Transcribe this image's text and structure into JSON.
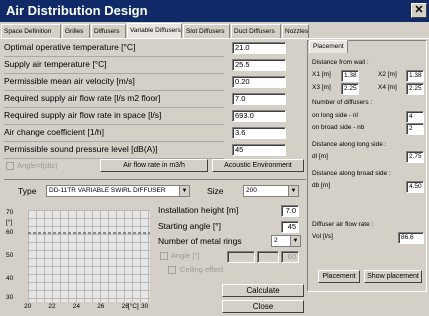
{
  "window": {
    "title": "Air Distribution Design",
    "close_glyph": "✕"
  },
  "tabs": [
    {
      "label": "Space Definition"
    },
    {
      "label": "Grilles"
    },
    {
      "label": "Diffusers"
    },
    {
      "label": "Variable Diffusers"
    },
    {
      "label": "Slot Diffusers"
    },
    {
      "label": "Duct Diffusers"
    },
    {
      "label": "Nozzles"
    }
  ],
  "params": [
    {
      "label": "Optimal operative temperature   [°C]",
      "value": "21.0"
    },
    {
      "label": "Supply air temperature   [°C]",
      "value": "25.5"
    },
    {
      "label": "Permissible mean air velocity   [m/s]",
      "value": "0.20"
    },
    {
      "label": "Required supply air flow rate   [l/s m2 floor]",
      "value": "7.0"
    },
    {
      "label": "Required supply air flow rate in space   [l/s]",
      "value": "693.0"
    },
    {
      "label": "Air change coefficient   [1/h]",
      "value": "3.6"
    },
    {
      "label": "Permissible sound pressure level   [dB(A)]",
      "value": "45"
    }
  ],
  "angle_check_label": "Angle=f(dtz)",
  "buttons": {
    "air_flow": "Air flow rate in m3/h",
    "acoustic": "Acoustic Environment",
    "calculate": "Calculate",
    "close": "Close",
    "placement": "Placement",
    "show_placement": "Show placement"
  },
  "type_row": {
    "type_label": "Type",
    "type_value": "DD-11TR  VARIABLE SWIRL DIFFUSER",
    "size_label": "Size",
    "size_value": "200"
  },
  "install": {
    "height_label": "Installation height  [m]",
    "height_value": "7.0",
    "angle_label": "Starting angle   [°]",
    "angle_value": "45",
    "rings_label": "Number of metal rings",
    "rings_value": "2",
    "angle2_label": "Angle   [°]",
    "angle2_value": "60",
    "ceiling_label": "Ceiling effect"
  },
  "chart_data": {
    "type": "line",
    "ylabel": "[°]",
    "xlabel": "[°C]",
    "x_ticks": [
      "20",
      "22",
      "24",
      "26",
      "28",
      "30"
    ],
    "y_ticks": [
      "70",
      "60",
      "50",
      "40",
      "30"
    ],
    "xlim": [
      20,
      30
    ],
    "ylim": [
      30,
      70
    ],
    "grid": true,
    "series": [
      {
        "x": [
          20,
          30
        ],
        "y": [
          60,
          60
        ]
      }
    ]
  },
  "placement": {
    "tab": "Placement",
    "distance_wall": "Distance from wall :",
    "x1_label": "X1  [m]",
    "x1": "1.38",
    "x2_label": "X2  [m]",
    "x2": "1.38",
    "x3_label": "X3  [m]",
    "x3": "2.25",
    "x4_label": "X4  [m]",
    "x4": "2.25",
    "num_diff": "Number of diffusers :",
    "long_side": "on long side - nl",
    "nl": "4",
    "broad_side": "on broad side - nb",
    "nb": "2",
    "dist_long": "Distance along long side :",
    "dl_label": "dl  [m]",
    "dl": "2.75",
    "dist_broad": "Distance along broad side :",
    "db_label": "db  [m]",
    "db": "4.50",
    "diff_air": "Diffuser air flow rate :",
    "vol_label": "Vol  [l/s]",
    "vol": "86.6"
  }
}
